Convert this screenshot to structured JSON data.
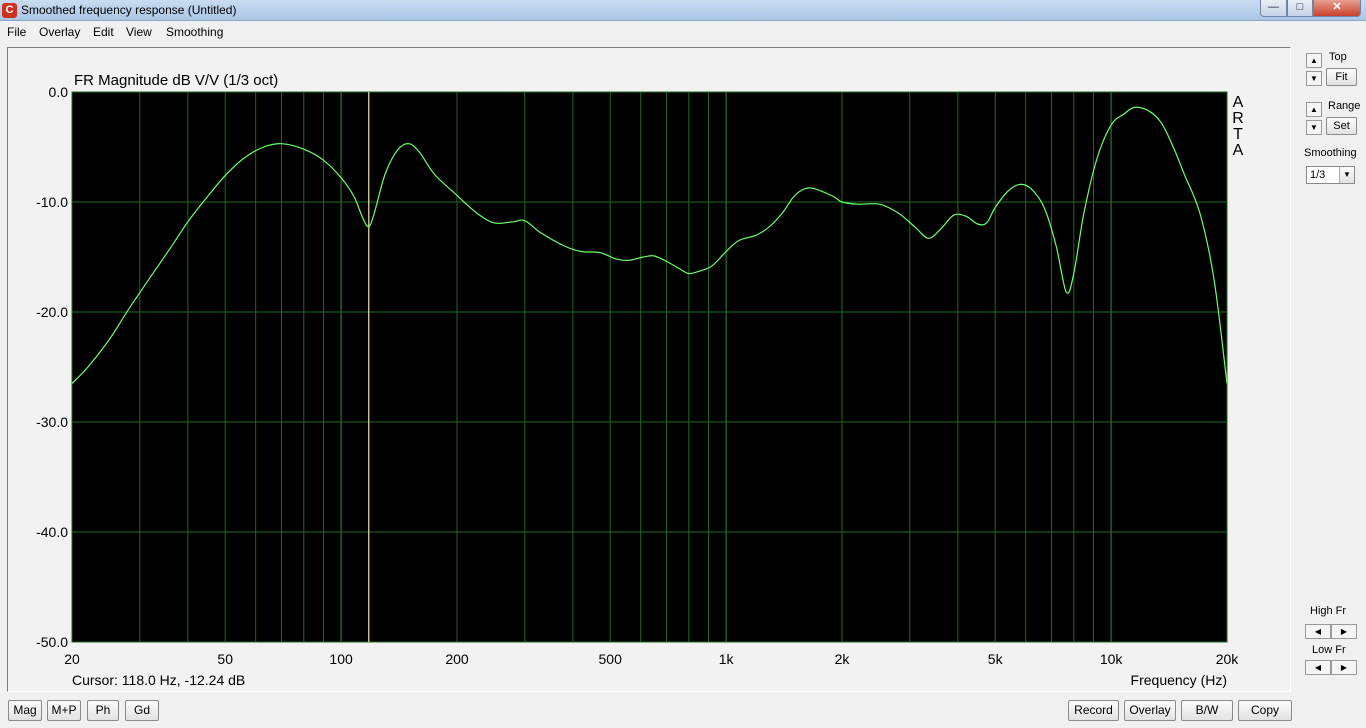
{
  "window": {
    "title": "Smoothed frequency response (Untitled)",
    "icon": "arta-app-icon",
    "icon_letter": "C"
  },
  "window_buttons": {
    "minimize": "—",
    "maximize": "□",
    "close": "✕"
  },
  "menu": {
    "items": [
      "File",
      "Overlay",
      "Edit",
      "View",
      "Smoothing"
    ]
  },
  "side_panel": {
    "top_label": "Top",
    "fit_label": "Fit",
    "range_label": "Range",
    "set_label": "Set",
    "smoothing_label": "Smoothing",
    "smoothing_value": "1/3",
    "high_fr_label": "High Fr",
    "low_fr_label": "Low Fr"
  },
  "bottom_buttons": {
    "left": [
      "Mag",
      "M+P",
      "Ph",
      "Gd"
    ],
    "right": [
      "Record",
      "Overlay",
      "B/W",
      "Copy"
    ]
  },
  "chart_data": {
    "type": "line",
    "title": "FR Magnitude dB V/V (1/3 oct)",
    "xlabel": "Frequency (Hz)",
    "ylabel": "",
    "xscale": "log",
    "xlim": [
      20,
      20000
    ],
    "ylim": [
      -50,
      0
    ],
    "yticks": [
      "0.0",
      "-10.0",
      "-20.0",
      "-30.0",
      "-40.0",
      "-50.0"
    ],
    "xticks": [
      {
        "value": 20,
        "label": "20"
      },
      {
        "value": 50,
        "label": "50"
      },
      {
        "value": 100,
        "label": "100"
      },
      {
        "value": 200,
        "label": "200"
      },
      {
        "value": 500,
        "label": "500"
      },
      {
        "value": 1000,
        "label": "1k"
      },
      {
        "value": 2000,
        "label": "2k"
      },
      {
        "value": 5000,
        "label": "5k"
      },
      {
        "value": 10000,
        "label": "10k"
      },
      {
        "value": 20000,
        "label": "20k"
      }
    ],
    "grid": true,
    "background": "#000000",
    "grid_color": "#1f6a1f",
    "line_color": "#6cff6c",
    "cursor_color": "#f2e6b0",
    "watermark": "ARTA",
    "cursor": {
      "frequency": 118.0,
      "level": -12.24,
      "text": "Cursor: 118.0 Hz, -12.24 dB"
    },
    "series": [
      {
        "points": [
          [
            20,
            -26.5
          ],
          [
            22,
            -25.0
          ],
          [
            25,
            -22.5
          ],
          [
            28,
            -19.8
          ],
          [
            32,
            -16.8
          ],
          [
            36,
            -14.2
          ],
          [
            40,
            -11.8
          ],
          [
            45,
            -9.5
          ],
          [
            50,
            -7.6
          ],
          [
            56,
            -6.0
          ],
          [
            63,
            -5.0
          ],
          [
            70,
            -4.7
          ],
          [
            80,
            -5.2
          ],
          [
            90,
            -6.2
          ],
          [
            100,
            -7.8
          ],
          [
            108,
            -9.5
          ],
          [
            114,
            -11.5
          ],
          [
            118,
            -12.24
          ],
          [
            122,
            -11.0
          ],
          [
            130,
            -7.5
          ],
          [
            140,
            -5.3
          ],
          [
            150,
            -4.7
          ],
          [
            160,
            -5.5
          ],
          [
            175,
            -7.5
          ],
          [
            200,
            -9.4
          ],
          [
            225,
            -11.0
          ],
          [
            250,
            -11.9
          ],
          [
            280,
            -11.8
          ],
          [
            300,
            -11.7
          ],
          [
            330,
            -12.8
          ],
          [
            380,
            -14.0
          ],
          [
            420,
            -14.5
          ],
          [
            470,
            -14.6
          ],
          [
            520,
            -15.2
          ],
          [
            560,
            -15.3
          ],
          [
            610,
            -15.0
          ],
          [
            650,
            -14.9
          ],
          [
            700,
            -15.4
          ],
          [
            760,
            -16.1
          ],
          [
            800,
            -16.5
          ],
          [
            850,
            -16.3
          ],
          [
            920,
            -15.8
          ],
          [
            1000,
            -14.5
          ],
          [
            1080,
            -13.5
          ],
          [
            1200,
            -13.0
          ],
          [
            1300,
            -12.2
          ],
          [
            1400,
            -11.0
          ],
          [
            1500,
            -9.5
          ],
          [
            1600,
            -8.8
          ],
          [
            1700,
            -8.8
          ],
          [
            1900,
            -9.5
          ],
          [
            2000,
            -10.0
          ],
          [
            2200,
            -10.2
          ],
          [
            2500,
            -10.2
          ],
          [
            2800,
            -11.0
          ],
          [
            3100,
            -12.3
          ],
          [
            3350,
            -13.3
          ],
          [
            3600,
            -12.5
          ],
          [
            3900,
            -11.2
          ],
          [
            4200,
            -11.3
          ],
          [
            4500,
            -12.0
          ],
          [
            4750,
            -11.9
          ],
          [
            5000,
            -10.5
          ],
          [
            5400,
            -9.0
          ],
          [
            5800,
            -8.4
          ],
          [
            6200,
            -8.8
          ],
          [
            6700,
            -10.5
          ],
          [
            7200,
            -14.0
          ],
          [
            7650,
            -18.2
          ],
          [
            8000,
            -16.5
          ],
          [
            8500,
            -11.0
          ],
          [
            9200,
            -6.0
          ],
          [
            10000,
            -3.0
          ],
          [
            10800,
            -2.0
          ],
          [
            11500,
            -1.4
          ],
          [
            12500,
            -1.7
          ],
          [
            13500,
            -2.8
          ],
          [
            14500,
            -5.0
          ],
          [
            15500,
            -7.5
          ],
          [
            17000,
            -11.0
          ],
          [
            18500,
            -17.0
          ],
          [
            20000,
            -26.5
          ]
        ]
      }
    ]
  }
}
